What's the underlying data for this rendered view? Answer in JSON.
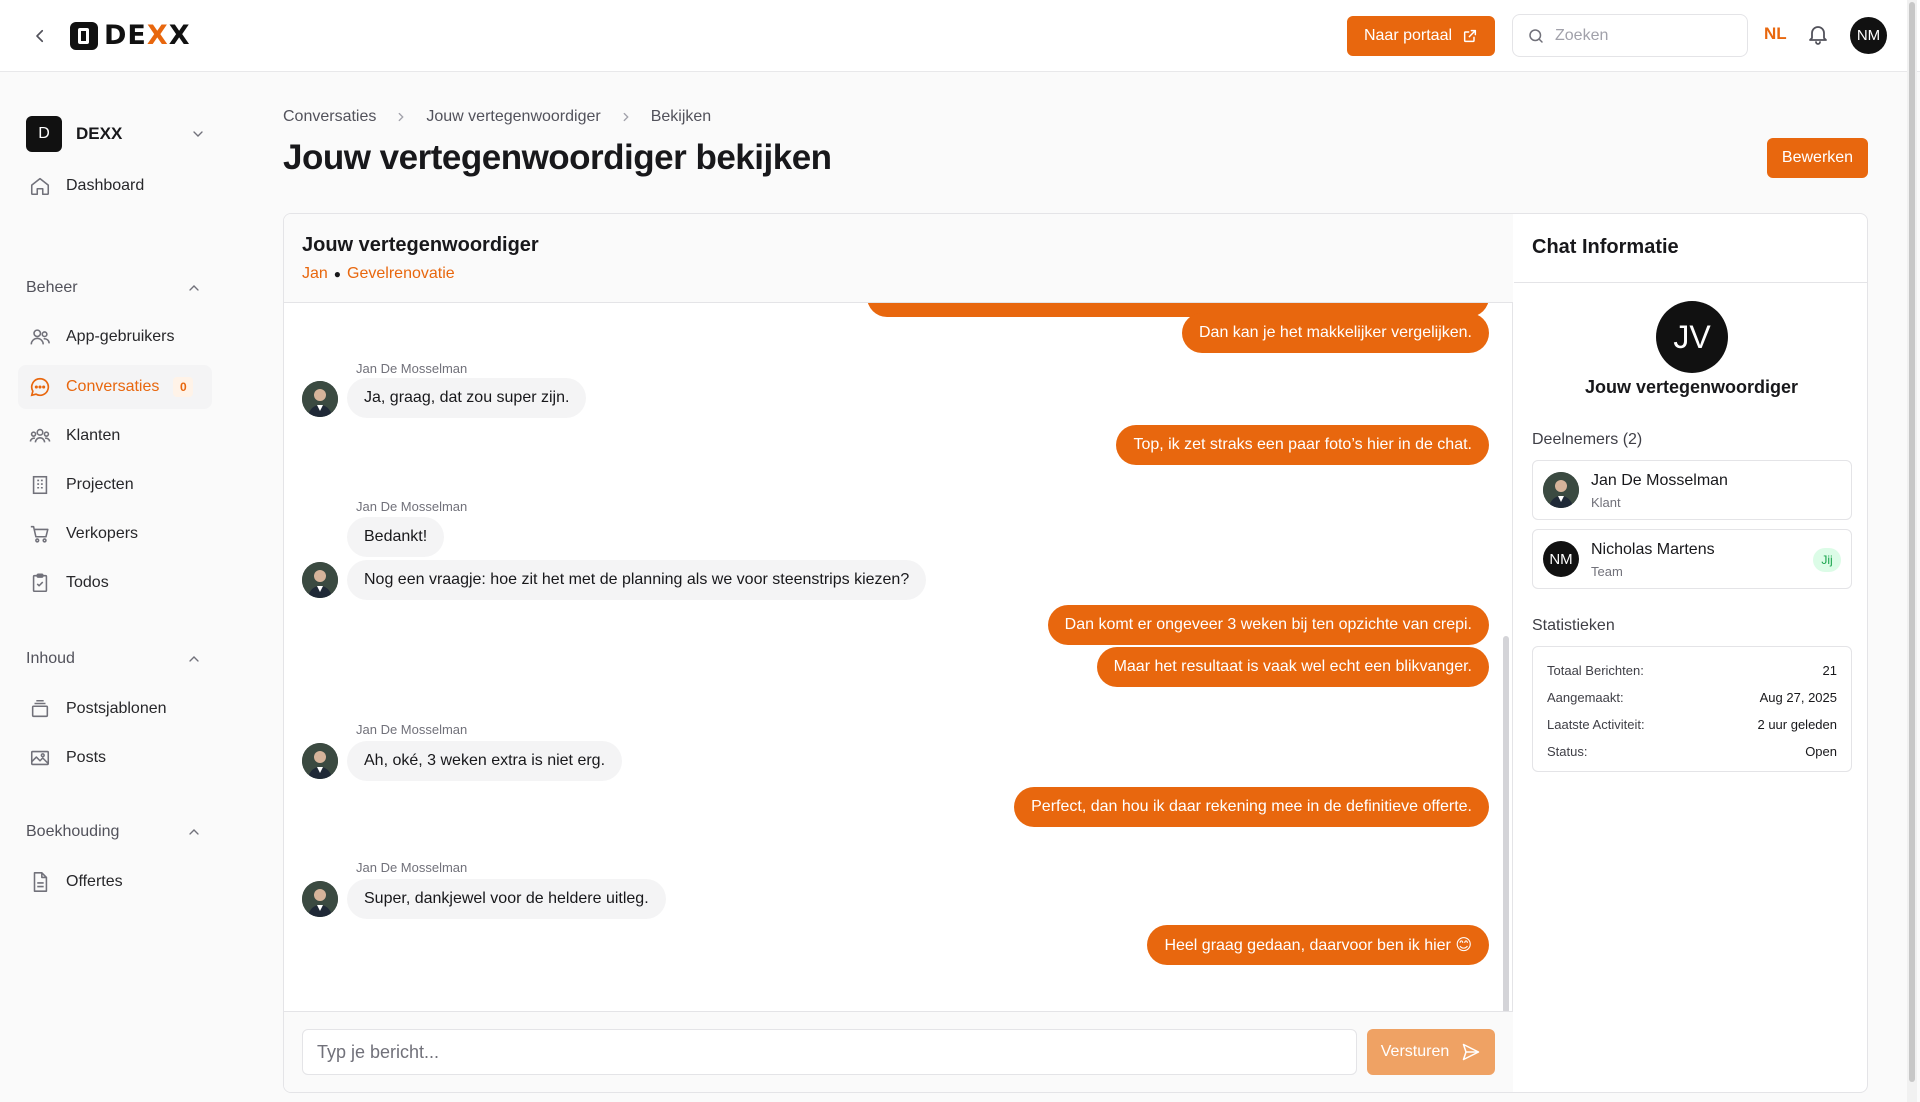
{
  "header": {
    "brand": "DEXX",
    "portal_button": "Naar portaal",
    "search_placeholder": "Zoeken",
    "language": "NL",
    "user_initials": "NM"
  },
  "sidebar": {
    "org": {
      "badge": "D",
      "name": "DEXX"
    },
    "dashboard": "Dashboard",
    "sections": {
      "beheer": "Beheer",
      "inhoud": "Inhoud",
      "boekhouding": "Boekhouding"
    },
    "items": {
      "app_users": "App-gebruikers",
      "conversations": "Conversaties",
      "conversations_count": "0",
      "clients": "Klanten",
      "projects": "Projecten",
      "sellers": "Verkopers",
      "todos": "Todos",
      "post_templates": "Postsjablonen",
      "posts": "Posts",
      "quotes": "Offertes"
    }
  },
  "page": {
    "breadcrumb": [
      "Conversaties",
      "Jouw vertegenwoordiger",
      "Bekijken"
    ],
    "title": "Jouw vertegenwoordiger bekijken",
    "edit_button": "Bewerken"
  },
  "chat": {
    "title": "Jouw vertegenwoordiger",
    "subtitle_person": "Jan",
    "subtitle_project": "Gevelrenovatie",
    "messages": [
      {
        "dir": "out",
        "text": "Dan kan je het makkelijker vergelijken."
      },
      {
        "dir": "in",
        "sender": "Jan De Mosselman",
        "text": "Ja, graag, dat zou super zijn."
      },
      {
        "dir": "out",
        "text": "Top, ik zet straks een paar foto’s hier in de chat."
      },
      {
        "dir": "in",
        "sender": "Jan De Mosselman",
        "text": "Bedankt!"
      },
      {
        "dir": "in",
        "text": "Nog een vraagje: hoe zit het met de planning als we voor steenstrips kiezen?"
      },
      {
        "dir": "out",
        "text": "Dan komt er ongeveer 3 weken bij ten opzichte van crepi."
      },
      {
        "dir": "out",
        "text": "Maar het resultaat is vaak wel echt een blikvanger."
      },
      {
        "dir": "in",
        "sender": "Jan De Mosselman",
        "text": "Ah, oké, 3 weken extra is niet erg."
      },
      {
        "dir": "out",
        "text": "Perfect, dan hou ik daar rekening mee in de definitieve offerte."
      },
      {
        "dir": "in",
        "sender": "Jan De Mosselman",
        "text": "Super, dankjewel voor de heldere uitleg."
      },
      {
        "dir": "out",
        "text": "Heel graag gedaan, daarvoor ben ik hier 😊"
      }
    ],
    "composer_placeholder": "Typ je bericht...",
    "send_button": "Versturen"
  },
  "info": {
    "title": "Chat Informatie",
    "initials": "JV",
    "name": "Jouw vertegenwoordiger",
    "participants_label": "Deelnemers (2)",
    "participants": [
      {
        "name": "Jan De Mosselman",
        "role": "Klant"
      },
      {
        "name": "Nicholas Martens",
        "role": "Team",
        "initials": "NM",
        "tag": "Jij"
      }
    ],
    "stats_label": "Statistieken",
    "stats": [
      {
        "label": "Totaal Berichten:",
        "value": "21"
      },
      {
        "label": "Aangemaakt:",
        "value": "Aug 27, 2025"
      },
      {
        "label": "Laatste Activiteit:",
        "value": "2 uur geleden"
      },
      {
        "label": "Status:",
        "value": "Open"
      }
    ]
  },
  "colors": {
    "accent": "#e8670e",
    "send_disabled": "#efa264"
  }
}
